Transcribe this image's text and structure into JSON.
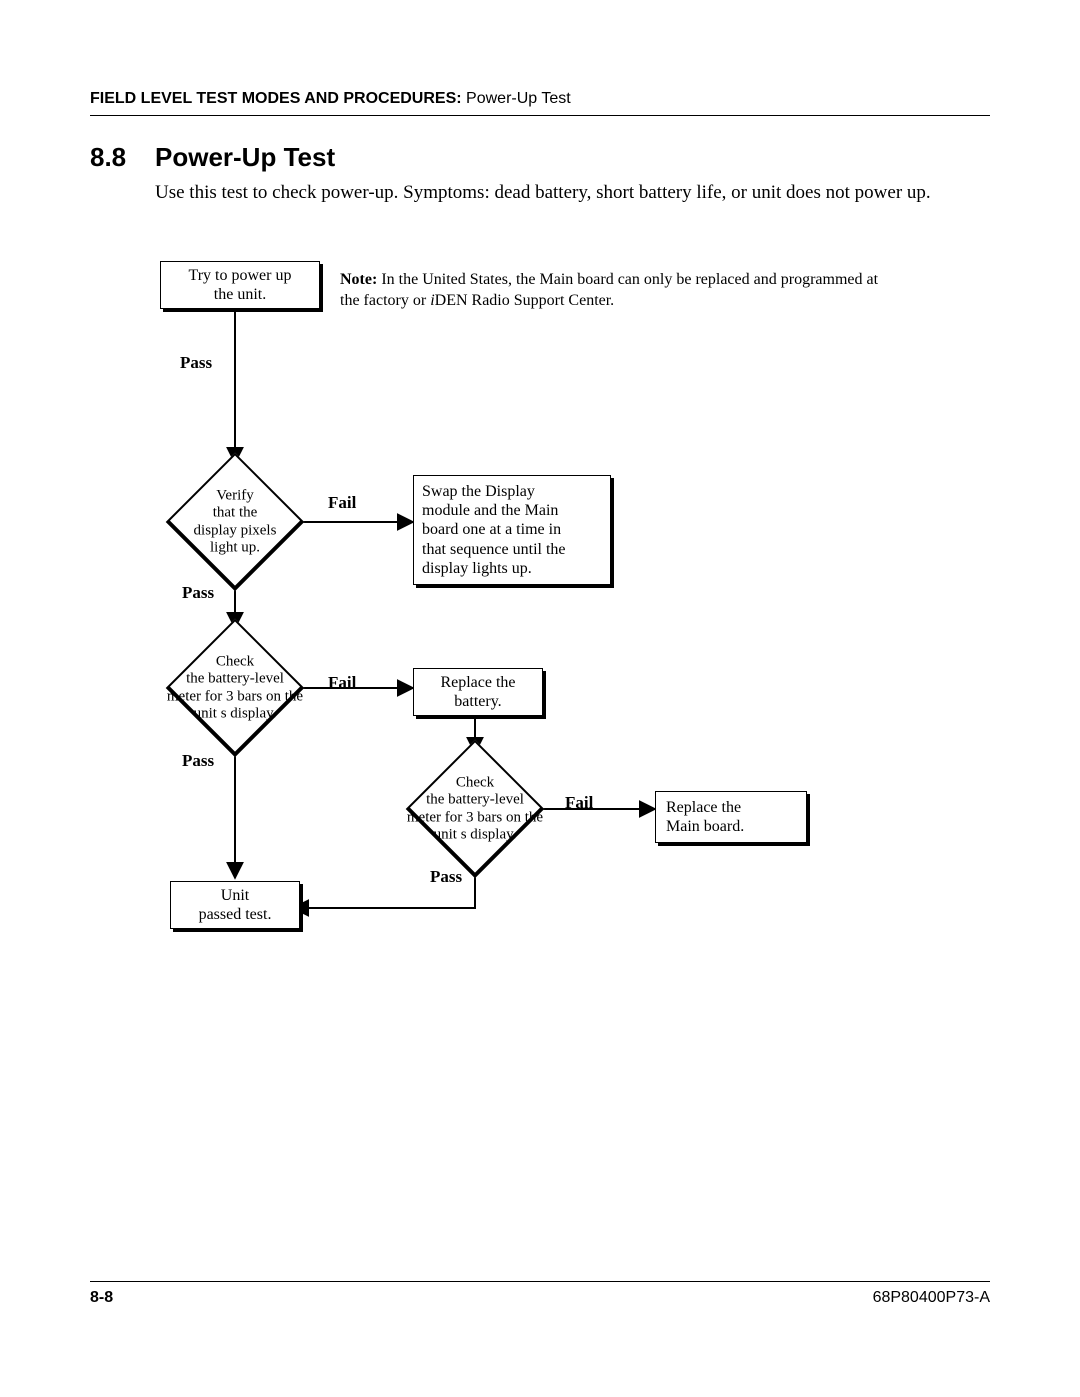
{
  "header": {
    "bold": "FIELD LEVEL TEST MODES AND PROCEDURES:",
    "rest": "  Power-Up Test"
  },
  "section": {
    "num": "8.8",
    "title": "Power-Up Test"
  },
  "intro": "Use this test to check power-up. Symptoms: dead battery, short battery life, or unit does not power up.",
  "note": {
    "label": "Note:",
    "text_before": " In the United States, the Main board can only be replaced and programmed at the factory or ",
    "iden": "i",
    "text_after": "DEN Radio Support Center."
  },
  "flow": {
    "start": "Try to power up\nthe unit.",
    "d1": "Verify\nthat the\ndisplay pixels\nlight up.",
    "swap": "Swap the Display\nmodule and the Main\nboard one at a time in\nthat sequence until the\ndisplay lights up.",
    "d2": "Check\nthe battery-level\nmeter for 3 bars on the\nunit s display.",
    "replace_batt": "Replace the\nbattery.",
    "d3": "Check\nthe battery-level\nmeter for 3 bars on the\nunit s display.",
    "replace_main": "Replace the\nMain board.",
    "end": "Unit\npassed test."
  },
  "labels": {
    "pass": "Pass",
    "fail": "Fail"
  },
  "footer": {
    "left": "8-8",
    "right": "68P80400P73-A"
  }
}
